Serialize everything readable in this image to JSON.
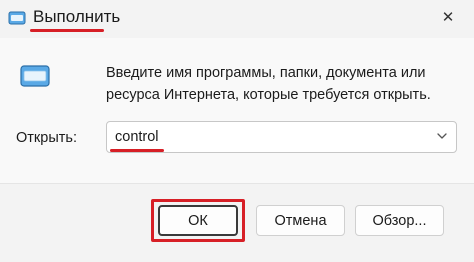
{
  "window": {
    "title": "Выполнить",
    "close_label": "✕"
  },
  "icons": {
    "title": "run-app-icon",
    "close": "close-icon",
    "content": "run-app-icon",
    "dropdown": "chevron-down-icon"
  },
  "content": {
    "description_line1": "Введите имя программы, папки, документа или",
    "description_line2": "ресурса Интернета, которые требуется открыть.",
    "open_label": "Открыть:",
    "open_value": "control"
  },
  "buttons": {
    "ok": "ОК",
    "cancel": "Отмена",
    "browse": "Обзор..."
  },
  "colors": {
    "highlight": "#d71f26",
    "window_bg": "#f3f3f3",
    "accent": "#0067c0"
  }
}
